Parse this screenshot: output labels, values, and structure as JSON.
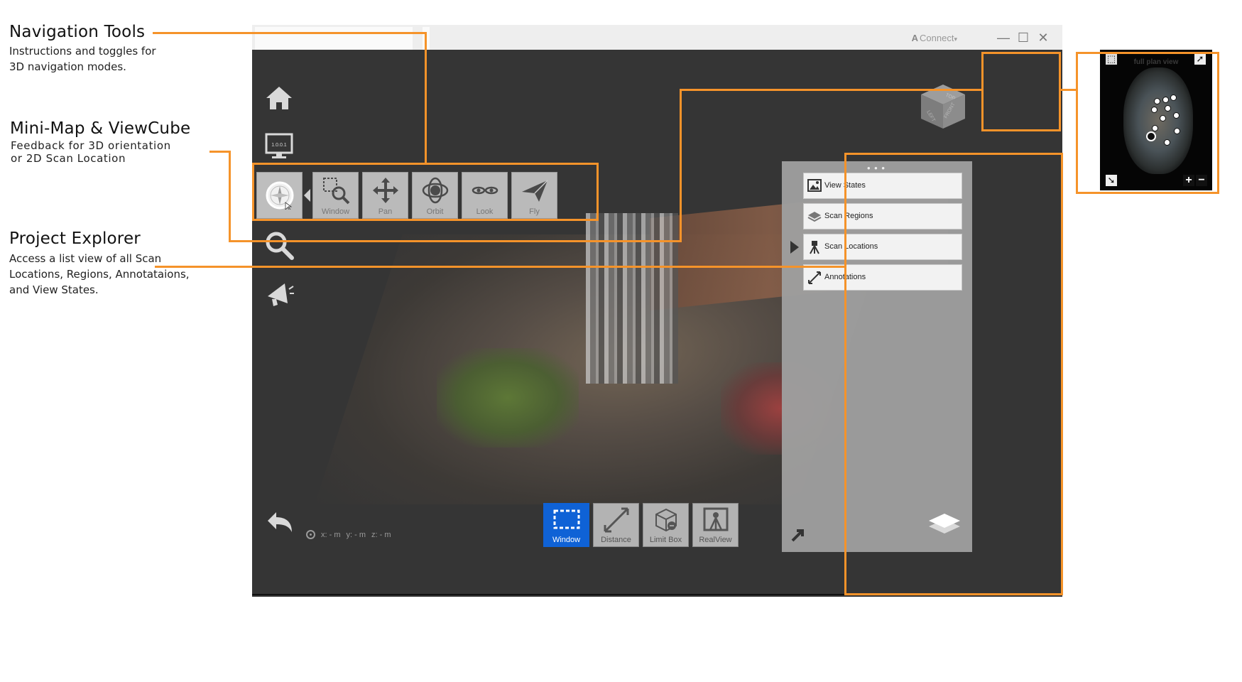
{
  "callouts": {
    "navigation": {
      "title": "Navigation Tools",
      "desc_line1": "Instructions and toggles for",
      "desc_line2": "3D navigation modes."
    },
    "minimap": {
      "title": "Mini-Map & ViewCube",
      "desc_line1": "Feedback for 3D orientation",
      "desc_line2": "or 2D Scan Location"
    },
    "explorer": {
      "title": "Project Explorer",
      "desc_line1": "Access a list view of all Scan",
      "desc_line2": "Locations, Regions, Annotataions,",
      "desc_line3": "and View States."
    }
  },
  "window": {
    "connect_logo": "A",
    "connect_label": "Connect",
    "connect_caret": "▾",
    "minimize": "—",
    "maximize": "☐",
    "close": "✕"
  },
  "rail": {
    "icons": [
      "home-icon",
      "monitor-icon",
      "navigation-compass-icon",
      "search-icon",
      "megaphone-icon",
      "undo-icon"
    ],
    "monitor_text": "1.0.0.1"
  },
  "nav_tools": [
    {
      "label": "Window",
      "icon": "window-zoom-icon"
    },
    {
      "label": "Pan",
      "icon": "pan-icon"
    },
    {
      "label": "Orbit",
      "icon": "orbit-icon"
    },
    {
      "label": "Look",
      "icon": "look-icon"
    },
    {
      "label": "Fly",
      "icon": "fly-icon"
    }
  ],
  "coords": {
    "x": "x: - m",
    "y": "y: - m",
    "z": "z: - m"
  },
  "bottom_tools": [
    {
      "label": "Window",
      "icon": "window-select-icon",
      "active": true
    },
    {
      "label": "Distance",
      "icon": "distance-icon",
      "active": false
    },
    {
      "label": "Limit Box",
      "icon": "limit-box-icon",
      "active": false
    },
    {
      "label": "RealView",
      "icon": "realview-icon",
      "active": false
    }
  ],
  "viewcube": {
    "top": "TOP",
    "left": "LEFT",
    "front": "FRONT"
  },
  "explorer": {
    "dots": "• • •",
    "items": [
      {
        "label": "View States",
        "icon": "view-states-icon"
      },
      {
        "label": "Scan Regions",
        "icon": "scan-regions-icon"
      },
      {
        "label": "Scan Locations",
        "icon": "scan-locations-icon"
      },
      {
        "label": "Annotations",
        "icon": "annotations-icon"
      }
    ]
  },
  "minimap": {
    "title": "full plan view",
    "zoom_in": "+",
    "zoom_out": "−"
  },
  "colors": {
    "accent_orange": "#f5932a",
    "active_blue": "#0f62d6",
    "viewport_bg": "#353535"
  }
}
